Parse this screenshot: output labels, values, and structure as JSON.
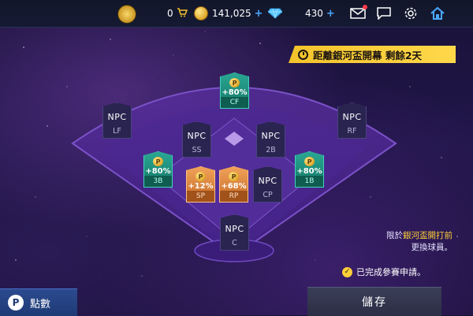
{
  "topbar": {
    "cart_count": "0",
    "coins": "141,025",
    "gems": "430",
    "plus": "+",
    "icons": [
      "medal-icon",
      "cart-icon",
      "coin-icon",
      "gem-icon",
      "mail-icon",
      "chat-icon",
      "gear-icon",
      "home-icon"
    ],
    "accent": "#4aa8ff"
  },
  "banner": {
    "text": "距離銀河盃開幕 剩餘2天",
    "color": "#ffd84a"
  },
  "field": {
    "cards": [
      {
        "key": "cf",
        "type": "teal",
        "pct": "+80%",
        "pos": "CF"
      },
      {
        "key": "lf",
        "type": "npc",
        "name": "NPC",
        "pos": "LF"
      },
      {
        "key": "rf",
        "type": "npc",
        "name": "NPC",
        "pos": "RF"
      },
      {
        "key": "ss",
        "type": "npc",
        "name": "NPC",
        "pos": "SS"
      },
      {
        "key": "2b",
        "type": "npc",
        "name": "NPC",
        "pos": "2B"
      },
      {
        "key": "3b",
        "type": "teal",
        "pct": "+80%",
        "pos": "3B"
      },
      {
        "key": "sp",
        "type": "orange",
        "pct": "+12%",
        "pos": "SP"
      },
      {
        "key": "rp",
        "type": "orange",
        "pct": "+68%",
        "pos": "RP"
      },
      {
        "key": "cp",
        "type": "npc",
        "name": "NPC",
        "pos": "CP"
      },
      {
        "key": "1b",
        "type": "teal",
        "pct": "+80%",
        "pos": "1B"
      },
      {
        "key": "c",
        "type": "npc",
        "name": "NPC",
        "pos": "C"
      }
    ],
    "badge_letter": "P"
  },
  "note": {
    "line1_prefix": "限於",
    "line1_highlight": "銀河盃開打前",
    "line2": "更換球員。"
  },
  "status": {
    "done_text": "已完成參賽申請。",
    "check": "✓"
  },
  "bottom": {
    "points_label": "點數",
    "points_icon_letter": "P",
    "save_label": "儲存"
  }
}
